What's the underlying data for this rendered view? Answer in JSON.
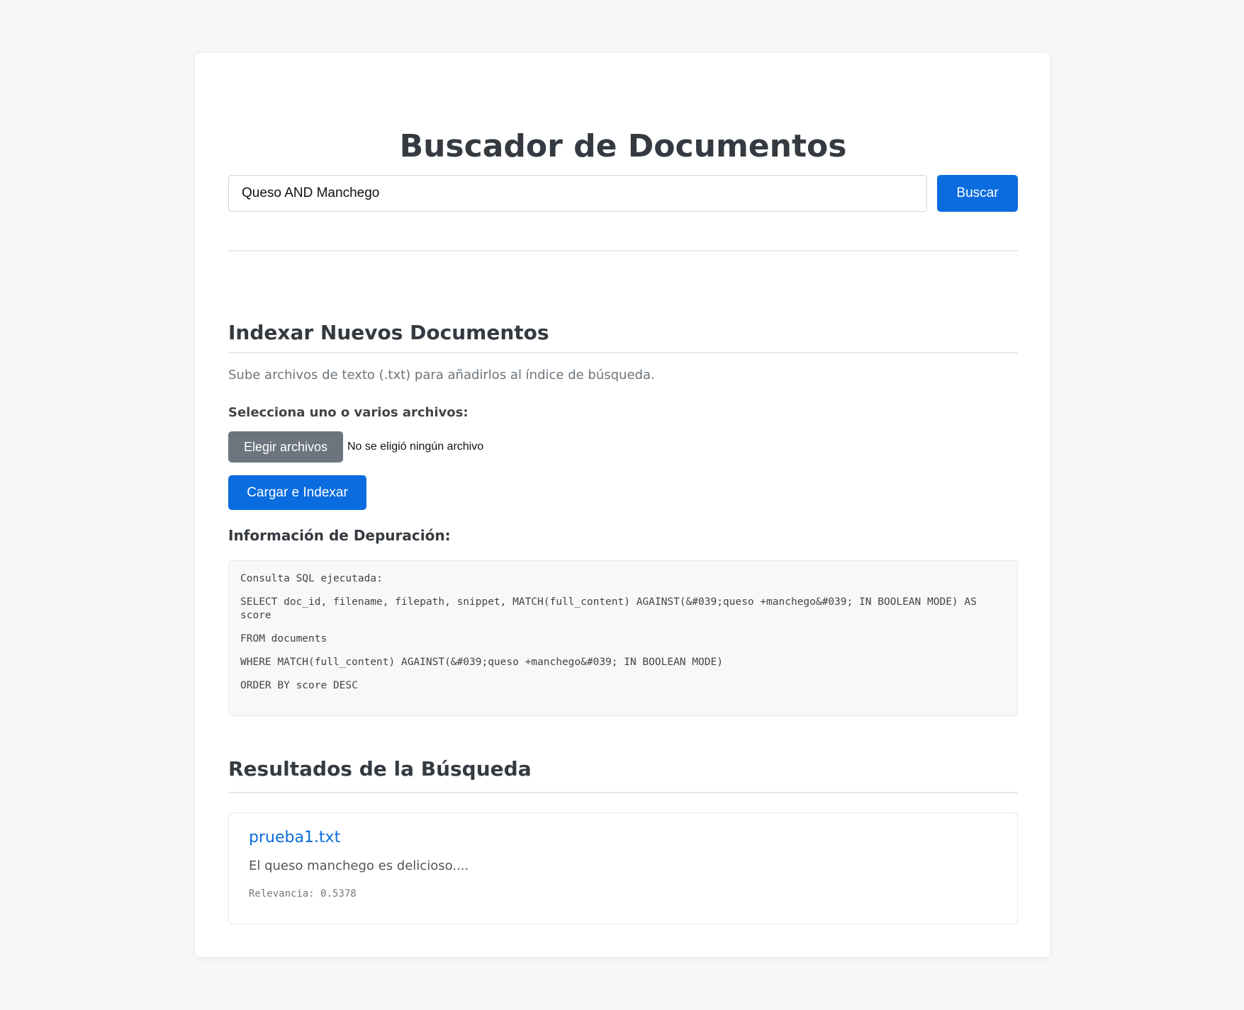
{
  "header": {
    "title": "Buscador de Documentos"
  },
  "search": {
    "value": "Queso AND Manchego",
    "button_label": "Buscar"
  },
  "index_section": {
    "title": "Indexar Nuevos Documentos",
    "description": "Sube archivos de texto (.txt) para añadirlos al índice de búsqueda.",
    "files_label": "Selecciona uno o varios archivos:",
    "choose_button_label": "Elegir archivos",
    "file_status": "No se eligió ningún archivo",
    "upload_button_label": "Cargar e Indexar"
  },
  "debug": {
    "title": "Información de Depuración:",
    "lines": [
      "Consulta SQL ejecutada:",
      "SELECT doc_id, filename, filepath, snippet, MATCH(full_content) AGAINST(&#039;queso +manchego&#039; IN BOOLEAN MODE) AS score",
      "FROM documents",
      "WHERE MATCH(full_content) AGAINST(&#039;queso +manchego&#039; IN BOOLEAN MODE)",
      "ORDER BY score DESC"
    ]
  },
  "results": {
    "title": "Resultados de la Búsqueda",
    "items": [
      {
        "filename": "prueba1.txt",
        "snippet": "El queso manchego es delicioso....",
        "relevance": "Relevancia: 0.5378"
      }
    ]
  },
  "colors": {
    "accent": "#0a6cdf",
    "secondary_button": "#6c757d",
    "background": "#f6f7f9"
  }
}
